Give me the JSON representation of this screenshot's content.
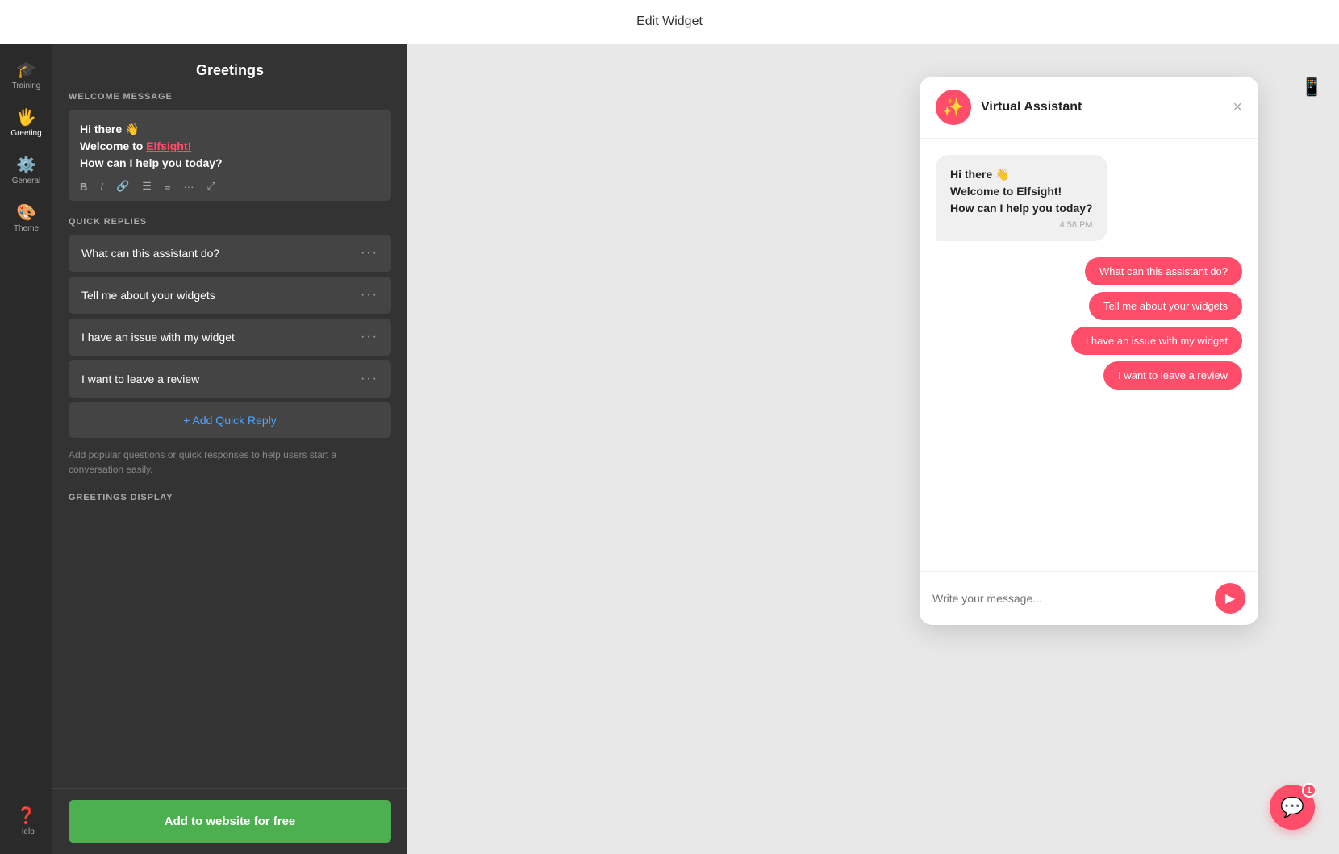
{
  "topBar": {
    "title": "Edit Widget"
  },
  "sidebar": {
    "items": [
      {
        "id": "training",
        "label": "Training",
        "icon": "🎓"
      },
      {
        "id": "greeting",
        "label": "Greeting",
        "icon": "👋",
        "active": true
      },
      {
        "id": "general",
        "label": "General",
        "icon": "⚙️"
      },
      {
        "id": "theme",
        "label": "Theme",
        "icon": "🎨"
      }
    ],
    "bottomItems": [
      {
        "id": "help",
        "label": "Help",
        "icon": "❓"
      }
    ]
  },
  "leftPanel": {
    "title": "Greetings",
    "welcomeMessageLabel": "WELCOME MESSAGE",
    "welcomeMessage": {
      "line1": "Hi there 👋",
      "line2_prefix": "Welcome to ",
      "line2_highlight": "Elfsight!",
      "line3": "How can I help you today?"
    },
    "quickRepliesLabel": "QUICK REPLIES",
    "quickReplies": [
      {
        "id": 1,
        "text": "What can this assistant do?"
      },
      {
        "id": 2,
        "text": "Tell me about your widgets"
      },
      {
        "id": 3,
        "text": "I have an issue with my widget"
      },
      {
        "id": 4,
        "text": "I want to leave a review"
      }
    ],
    "addQuickReplyLabel": "+ Add Quick Reply",
    "helperText": "Add popular questions or quick responses to help users start a conversation easily.",
    "greetingsDisplayLabel": "GREETINGS DISPLAY",
    "addToWebsiteLabel": "Add to website for free"
  },
  "chatPreview": {
    "header": {
      "title": "Virtual Assistant",
      "avatarEmoji": "✨",
      "closeLabel": "×"
    },
    "welcomeMessage": {
      "line1": "Hi there 👋",
      "line2": "Welcome to Elfsight!",
      "line3": "How can I help you today?",
      "time": "4:58 PM"
    },
    "quickReplies": [
      "What can this assistant do?",
      "Tell me about your widgets",
      "I have an issue with my widget",
      "I want to leave a review"
    ],
    "inputPlaceholder": "Write your message...",
    "sendIcon": "▶"
  },
  "floatingBtn": {
    "notificationCount": "1"
  }
}
